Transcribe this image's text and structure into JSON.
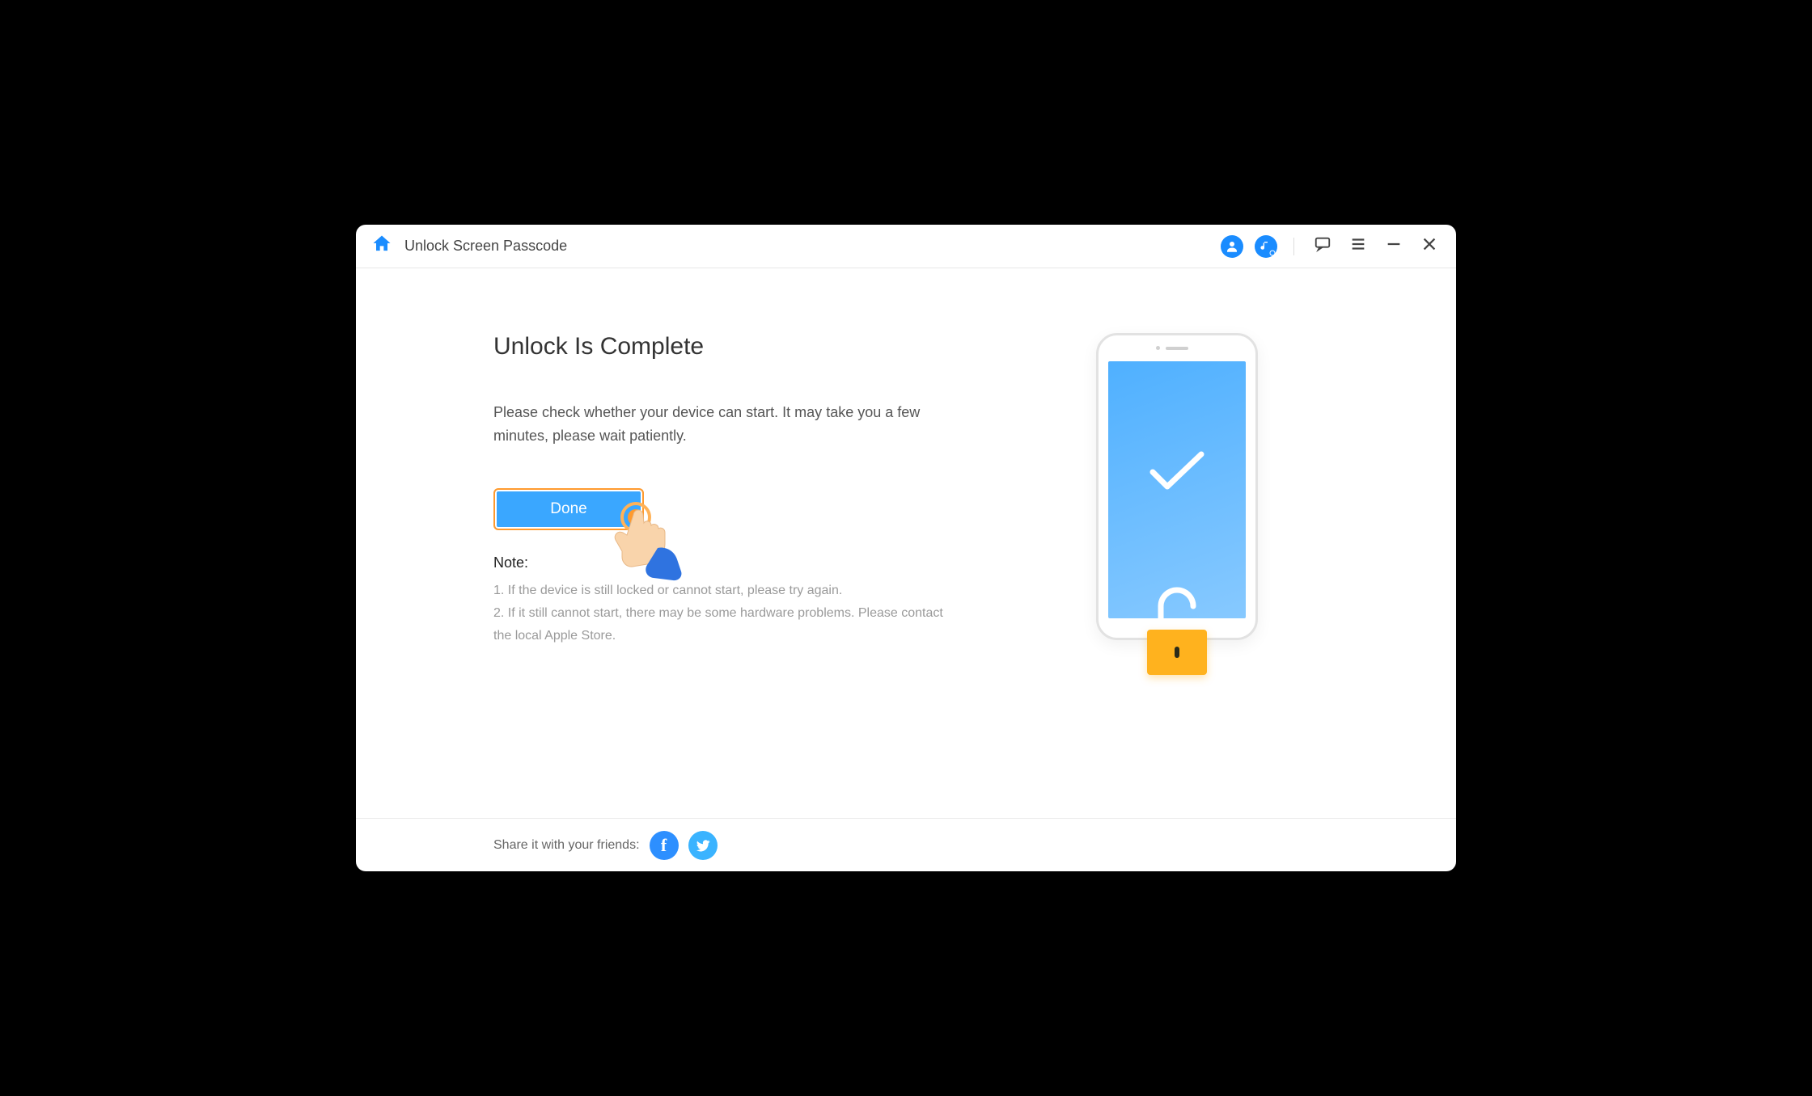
{
  "header": {
    "title": "Unlock Screen Passcode"
  },
  "main": {
    "heading": "Unlock Is Complete",
    "subtext": "Please check whether your device can start. It may take you a few minutes, please wait patiently.",
    "done_label": "Done",
    "note_heading": "Note:",
    "notes": [
      "1. If the device is still locked or cannot start, please try again.",
      "2. If it still cannot start, there may be some hardware problems. Please contact the local Apple Store."
    ]
  },
  "footer": {
    "share_label": "Share it with your friends:"
  },
  "icons": {
    "home": "home-icon",
    "account": "account-icon",
    "music_search": "music-search-icon",
    "feedback": "feedback-icon",
    "menu": "menu-icon",
    "minimize": "minimize-icon",
    "close": "close-icon",
    "facebook": "facebook-icon",
    "twitter": "twitter-icon"
  },
  "colors": {
    "accent": "#1a8cff",
    "button_bg": "#3aa7ff",
    "button_outline": "#ff9a2e",
    "lock": "#ffb21e"
  }
}
